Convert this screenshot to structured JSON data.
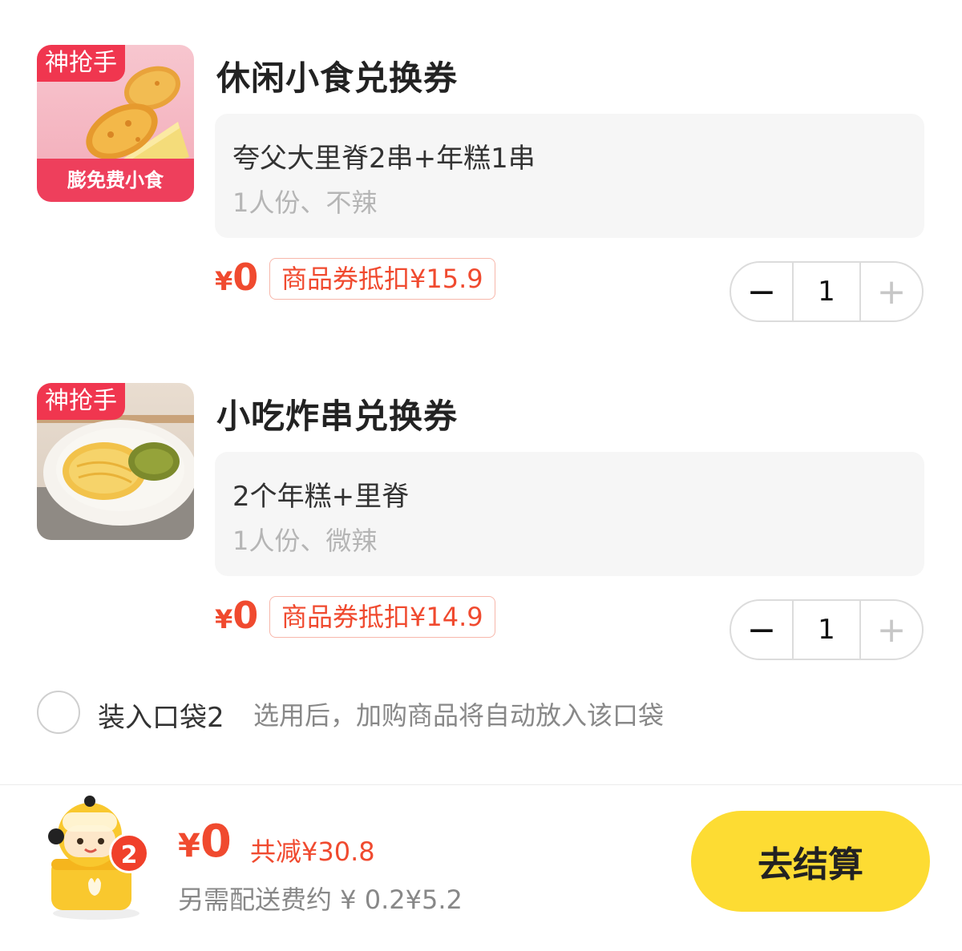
{
  "items": [
    {
      "thumb_tag": "神抢手",
      "thumb_band": "膨免费小食",
      "title": "休闲小食兑换券",
      "spec_name": "夸父大里脊2串+年糕1串",
      "spec_sub": "1人份、不辣",
      "price_symbol": "¥",
      "price_value": "0",
      "deduction": "商品券抵扣¥15.9",
      "quantity": "1",
      "minus_symbol": "−",
      "plus_symbol": "+"
    },
    {
      "thumb_tag": "神抢手",
      "title": "小吃炸串兑换券",
      "spec_name": "2个年糕+里脊",
      "spec_sub": "1人份、微辣",
      "price_symbol": "¥",
      "price_value": "0",
      "deduction": "商品券抵扣¥14.9",
      "quantity": "1",
      "minus_symbol": "−",
      "plus_symbol": "+"
    }
  ],
  "bag_option": {
    "label": "装入口袋2",
    "hint": "选用后，加购商品将自动放入该口袋",
    "checked": false
  },
  "footer": {
    "cart_count": "2",
    "total_symbol": "¥",
    "total_value": "0",
    "saved": "共减¥30.8",
    "delivery": "另需配送费约 ¥ 0.2¥5.2",
    "checkout_label": "去结算"
  },
  "colors": {
    "accent_red": "#f04a2f",
    "checkout_yellow": "#fddc33",
    "tag_pink": "#f0364f"
  }
}
